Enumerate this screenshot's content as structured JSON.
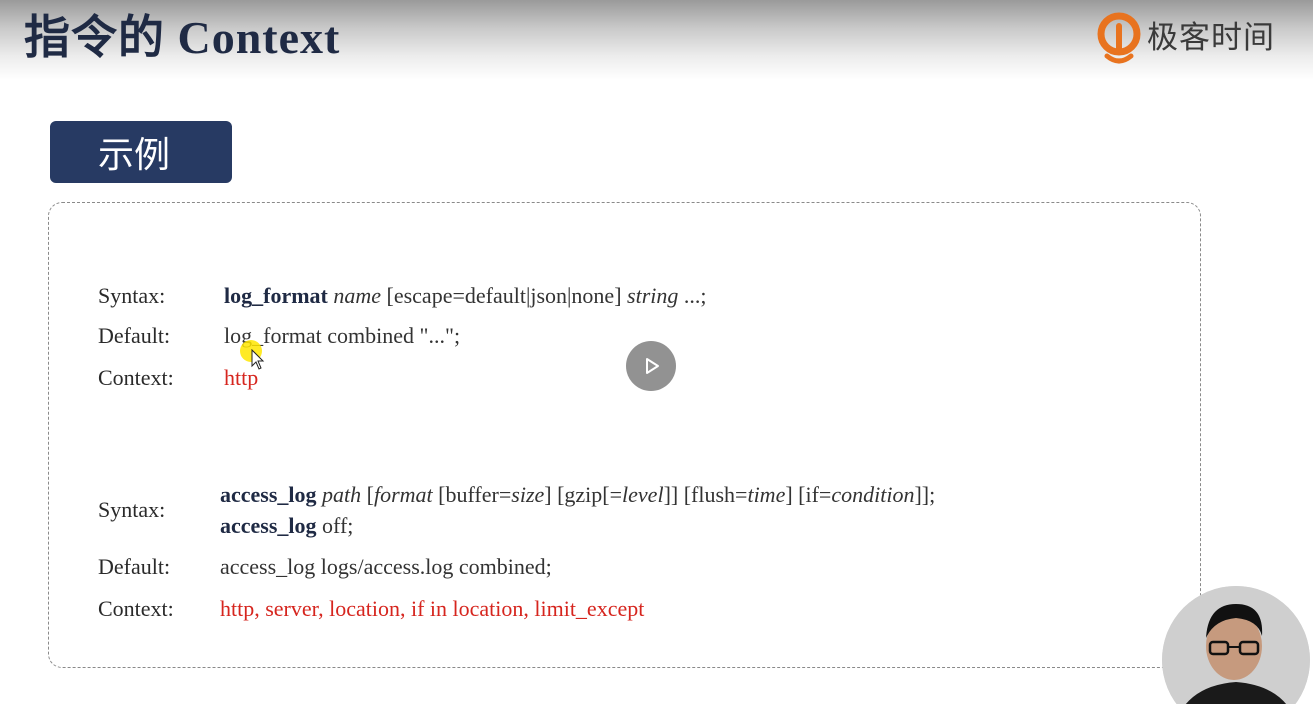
{
  "header": {
    "title": "指令的 Context",
    "brand": "极客时间"
  },
  "section_tab": "示例",
  "log_format": {
    "syntax_label": "Syntax:",
    "default_label": "Default:",
    "context_label": "Context:",
    "syntax_keyword": "log_format",
    "syntax_arg1": "name",
    "syntax_mid": "[escape=default|json|none]",
    "syntax_arg2": "string",
    "syntax_end": "...;",
    "default_value": "log_format combined \"...\";",
    "context_value": "http"
  },
  "access_log": {
    "syntax_label": "Syntax:",
    "default_label": "Default:",
    "context_label": "Context:",
    "syntax1_keyword": "access_log",
    "syntax1_p1": "path",
    "syntax1_p2": "[",
    "syntax1_p3": "format",
    "syntax1_p4": "[buffer=",
    "syntax1_p5": "size",
    "syntax1_p6": "] [gzip[=",
    "syntax1_p7": "level",
    "syntax1_p8": "]] [flush=",
    "syntax1_p9": "time",
    "syntax1_p10": "] [if=",
    "syntax1_p11": "condition",
    "syntax1_p12": "]];",
    "syntax2_keyword": "access_log",
    "syntax2_value": "off;",
    "default_value": "access_log logs/access.log combined;",
    "context_value": "http, server, location, if in location, limit_except"
  },
  "colors": {
    "title": "#1f2a44",
    "tab_bg": "#273a63",
    "context_red": "#d6251e",
    "logo_orange": "#e8731f"
  },
  "icons": {
    "play": "play-icon",
    "cursor": "mouse-cursor-icon",
    "logo": "geektime-logo-icon"
  }
}
